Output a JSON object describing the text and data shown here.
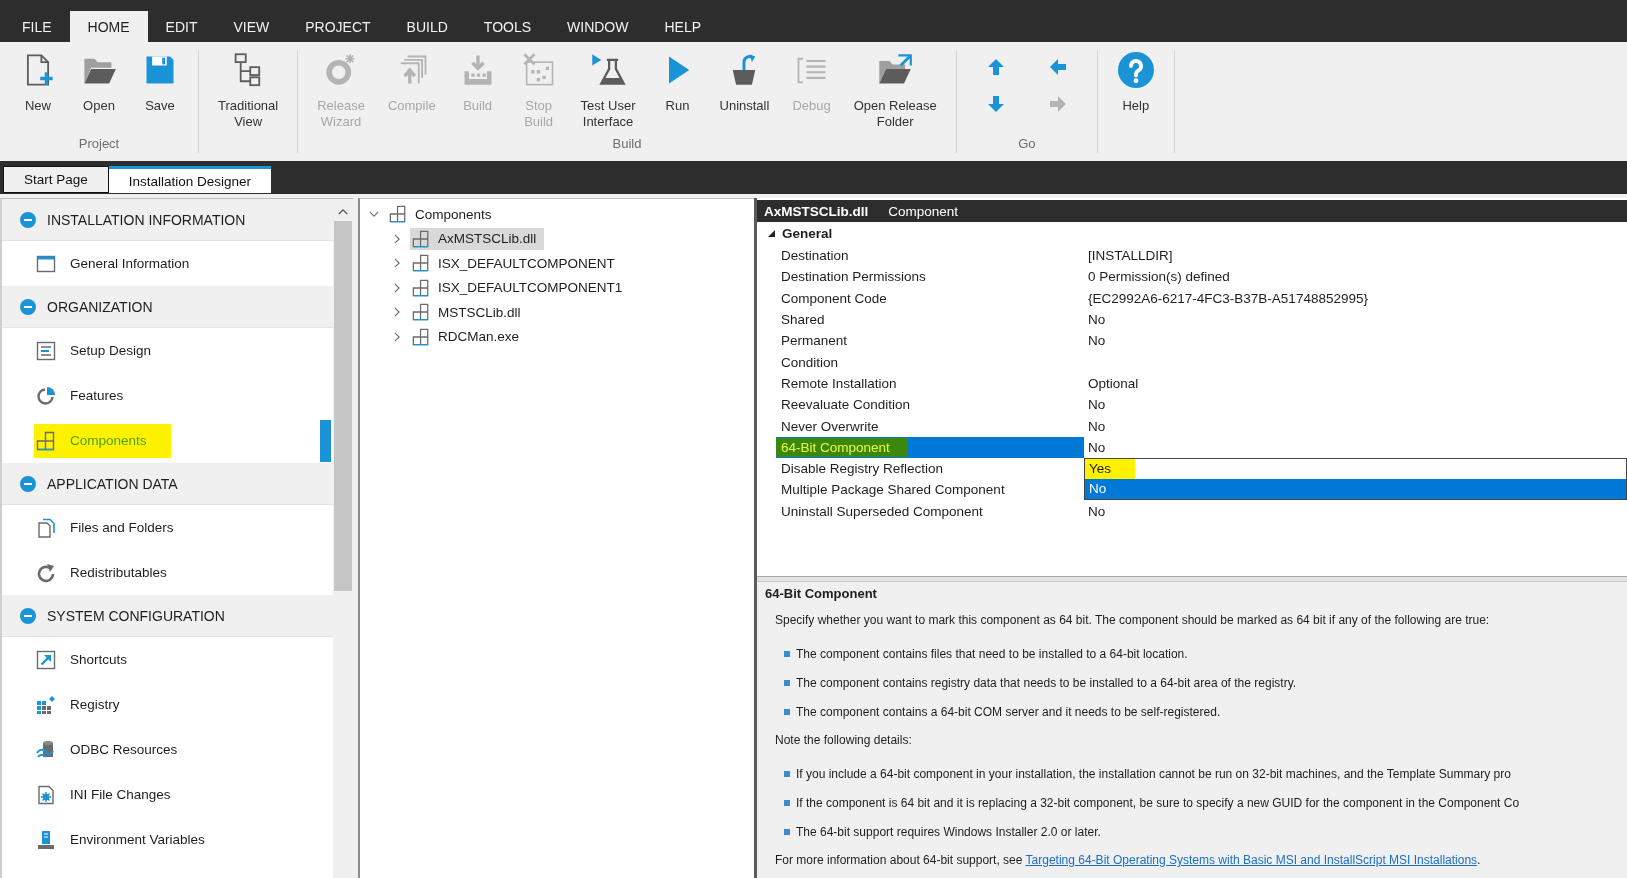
{
  "menu": [
    {
      "label": "FILE",
      "selected": false
    },
    {
      "label": "HOME",
      "selected": true
    },
    {
      "label": "EDIT",
      "selected": false
    },
    {
      "label": "VIEW",
      "selected": false
    },
    {
      "label": "PROJECT",
      "selected": false
    },
    {
      "label": "BUILD",
      "selected": false
    },
    {
      "label": "TOOLS",
      "selected": false
    },
    {
      "label": "WINDOW",
      "selected": false
    },
    {
      "label": "HELP",
      "selected": false
    }
  ],
  "ribbon": {
    "groups": [
      {
        "kind": "large",
        "label": "Project",
        "buttons": [
          {
            "label": "New",
            "disabled": false
          },
          {
            "label": "Open",
            "disabled": false
          },
          {
            "label": "Save",
            "disabled": false
          }
        ]
      },
      {
        "kind": "large",
        "buttons": [
          {
            "label": "Traditional\nView",
            "disabled": false
          }
        ]
      },
      {
        "kind": "large",
        "label": "Build",
        "buttons": [
          {
            "label": "Release\nWizard",
            "disabled": true
          },
          {
            "label": "Compile",
            "disabled": true
          },
          {
            "label": "Build",
            "disabled": true
          },
          {
            "label": "Stop\nBuild",
            "disabled": true
          },
          {
            "label": "Test User\nInterface",
            "disabled": false
          },
          {
            "label": "Run",
            "disabled": false
          },
          {
            "label": "Uninstall",
            "disabled": false
          },
          {
            "label": "Debug",
            "disabled": true
          },
          {
            "label": "Open Release\nFolder",
            "disabled": false
          }
        ]
      },
      {
        "kind": "arrows",
        "label": "Go",
        "buttons": [
          {
            "disabled": false
          },
          {
            "disabled": false
          },
          {
            "disabled": false
          },
          {
            "disabled": true
          }
        ]
      },
      {
        "kind": "large",
        "buttons": [
          {
            "label": "Help",
            "disabled": false
          }
        ]
      }
    ]
  },
  "document_tabs": [
    {
      "label": "Start Page",
      "selected": false
    },
    {
      "label": "Installation Designer",
      "selected": true
    }
  ],
  "sidebar": {
    "groups": [
      {
        "label": "INSTALLATION INFORMATION",
        "expanded": true,
        "items": [
          {
            "label": "General Information",
            "selected": false,
            "highlighted": false
          }
        ]
      },
      {
        "label": "ORGANIZATION",
        "expanded": true,
        "items": [
          {
            "label": "Setup Design",
            "selected": false,
            "highlighted": false
          },
          {
            "label": "Features",
            "selected": false,
            "highlighted": false
          },
          {
            "label": "Components",
            "selected": true,
            "highlighted": true
          }
        ]
      },
      {
        "label": "APPLICATION DATA",
        "expanded": true,
        "items": [
          {
            "label": "Files and Folders",
            "selected": false,
            "highlighted": false
          },
          {
            "label": "Redistributables",
            "selected": false,
            "highlighted": false
          }
        ]
      },
      {
        "label": "SYSTEM CONFIGURATION",
        "expanded": true,
        "items": [
          {
            "label": "Shortcuts",
            "selected": false,
            "highlighted": false
          },
          {
            "label": "Registry",
            "selected": false,
            "highlighted": false
          },
          {
            "label": "ODBC Resources",
            "selected": false,
            "highlighted": false
          },
          {
            "label": "INI File Changes",
            "selected": false,
            "highlighted": false
          },
          {
            "label": "Environment Variables",
            "selected": false,
            "highlighted": false
          }
        ]
      }
    ]
  },
  "tree": {
    "root": {
      "label": "Components",
      "expanded": true,
      "selected": false,
      "children": [
        {
          "label": "AxMSTSCLib.dll",
          "expanded": false,
          "selected": true
        },
        {
          "label": "ISX_DEFAULTCOMPONENT",
          "expanded": false,
          "selected": false
        },
        {
          "label": "ISX_DEFAULTCOMPONENT1",
          "expanded": false,
          "selected": false
        },
        {
          "label": "MSTSCLib.dll",
          "expanded": false,
          "selected": false
        },
        {
          "label": "RDCMan.exe",
          "expanded": false,
          "selected": false
        }
      ]
    }
  },
  "properties": {
    "title": "AxMSTSCLib.dll",
    "subtitle": "Component",
    "categories": [
      {
        "label": "General",
        "expanded": true,
        "rows": [
          {
            "name": "Destination",
            "value": "[INSTALLDIR]",
            "selected": false,
            "highlighted": false
          },
          {
            "name": "Destination Permissions",
            "value": "0 Permission(s) defined",
            "selected": false,
            "highlighted": false
          },
          {
            "name": "Component Code",
            "value": "{EC2992A6-6217-4FC3-B37B-A51748852995}",
            "selected": false,
            "highlighted": false
          },
          {
            "name": "Shared",
            "value": "No",
            "selected": false,
            "highlighted": false
          },
          {
            "name": "Permanent",
            "value": "No",
            "selected": false,
            "highlighted": false
          },
          {
            "name": "Condition",
            "selected": false,
            "highlighted": false
          },
          {
            "name": "Remote Installation",
            "value": "Optional",
            "selected": false,
            "highlighted": false
          },
          {
            "name": "Reevaluate Condition",
            "value": "No",
            "selected": false,
            "highlighted": false
          },
          {
            "name": "Never Overwrite",
            "value": "No",
            "selected": false,
            "highlighted": false
          },
          {
            "name": "64-Bit Component",
            "value": "No",
            "selected": true,
            "highlighted": true,
            "dropdown": {
              "options": [
                {
                  "label": "Yes",
                  "selected": false,
                  "highlighted": true
                },
                {
                  "label": "No",
                  "selected": true,
                  "highlighted": false
                }
              ]
            }
          },
          {
            "name": "Disable Registry Reflection",
            "selected": false,
            "highlighted": false
          },
          {
            "name": "Multiple Package Shared Component",
            "selected": false,
            "highlighted": false
          },
          {
            "name": "Uninstall Superseded Component",
            "value": "No",
            "selected": false,
            "highlighted": false
          }
        ]
      }
    ]
  },
  "help": {
    "title": "64-Bit Component",
    "blocks": [
      {
        "kind": "paragraph",
        "text": "Specify whether you want to mark this component as 64 bit. The component should be marked as 64 bit if any of the following are true:"
      },
      {
        "kind": "bullet",
        "text": "The component contains files that need to be installed to a 64-bit location."
      },
      {
        "kind": "bullet",
        "text": "The component contains registry data that needs to be installed to a 64-bit area of the registry."
      },
      {
        "kind": "bullet",
        "text": "The component contains a 64-bit COM server and it needs to be self-registered."
      },
      {
        "kind": "paragraph",
        "text": "Note the following details:"
      },
      {
        "kind": "bullet",
        "text": "If you include a 64-bit component in your installation, the installation cannot be run on 32-bit machines, and the Template Summary pro"
      },
      {
        "kind": "bullet",
        "text": "If the component is 64 bit and it is replacing a 32-bit component, be sure to specify a new GUID for the component in the Component Co"
      },
      {
        "kind": "bullet",
        "text": "The 64-bit support requires Windows Installer 2.0 or later."
      },
      {
        "kind": "link_paragraph",
        "text": "For more information about 64-bit support, see",
        "link": "Targeting 64-Bit Operating Systems with Basic MSI and InstallScript MSI Installations",
        "end": "."
      }
    ]
  }
}
